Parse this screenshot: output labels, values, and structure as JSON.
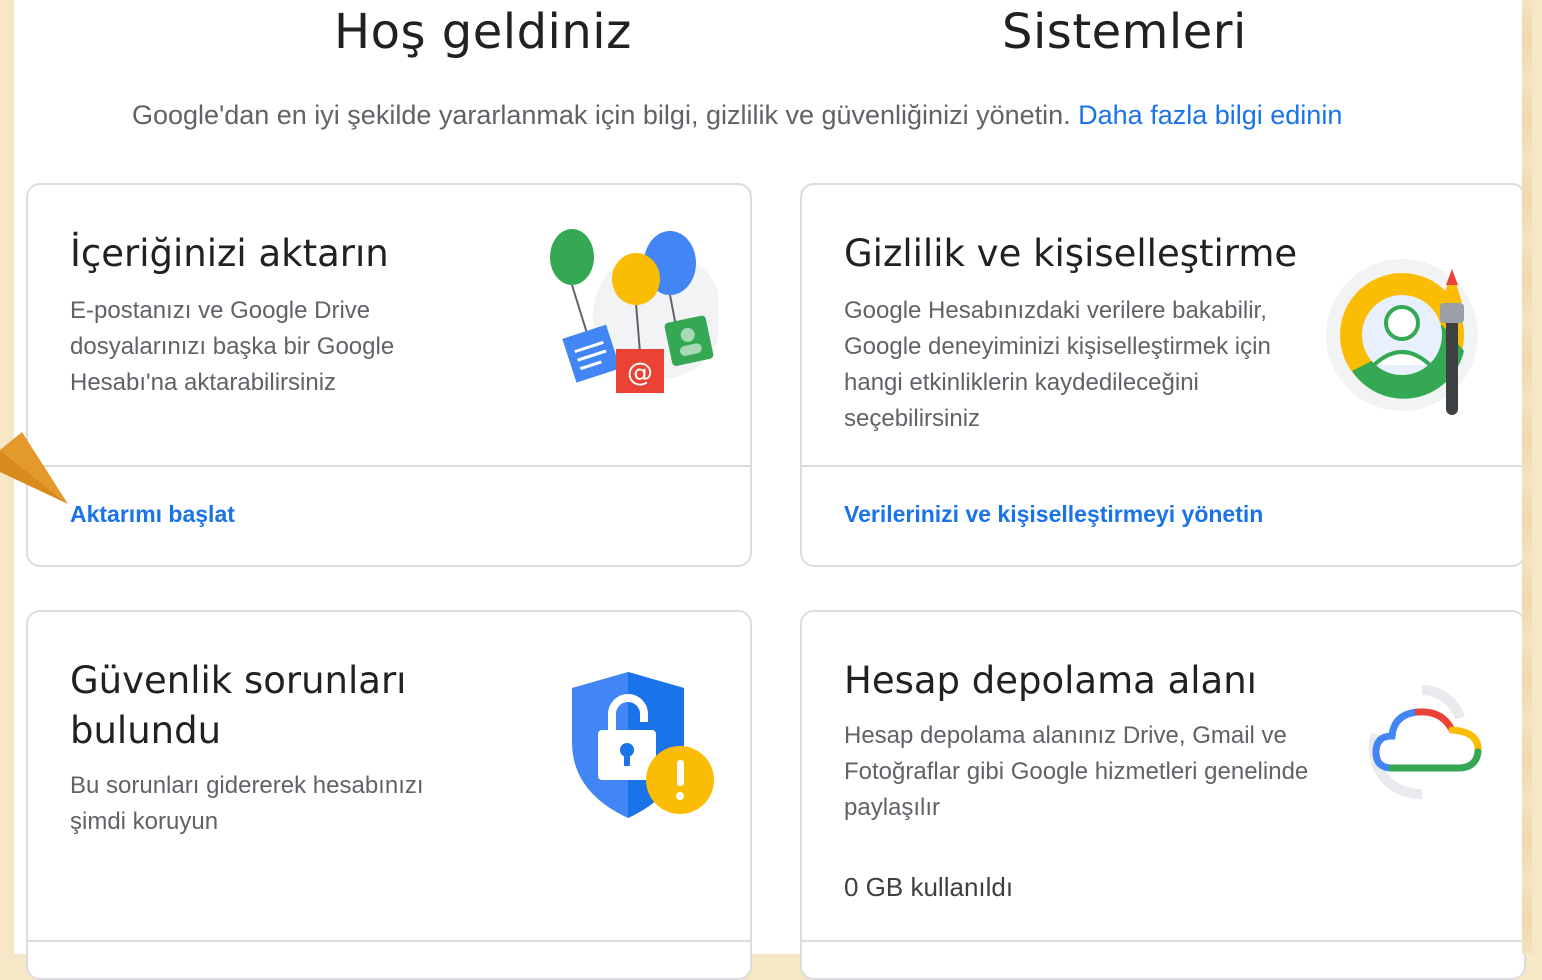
{
  "header": {
    "title_left": "Hoş geldiniz",
    "title_right": "Sistemleri",
    "subtitle": "Google'dan en iyi şekilde yararlanmak için bilgi, gizlilik ve güvenliğinizi yönetin.",
    "learn_more": "Daha fazla bilgi edinin"
  },
  "cards": {
    "transfer": {
      "title": "İçeriğinizi aktarın",
      "description": "E-postanızı ve Google Drive dosyalarınızı başka bir Google Hesabı'na aktarabilirsiniz",
      "action": "Aktarımı başlat",
      "icon": "balloons-icon"
    },
    "privacy": {
      "title": "Gizlilik ve kişiselleştirme",
      "description": "Google Hesabınızdaki verilere bakabilir, Google deneyiminizi kişiselleştirmek için hangi etkinliklerin kaydedileceğini seçebilirsiniz",
      "action": "Verilerinizi ve kişiselleştirmeyi yönetin",
      "icon": "privacy-paintbrush-icon"
    },
    "security": {
      "title": "Güvenlik sorunları bulundu",
      "description": "Bu sorunları gidererek hesabınızı şimdi koruyun",
      "icon": "shield-warning-icon"
    },
    "storage": {
      "title": "Hesap depolama alanı",
      "description": "Hesap depolama alanınız Drive, Gmail ve Fotoğraflar gibi Google hizmetleri genelinde paylaşılır",
      "usage": "0 GB kullanıldı",
      "icon": "cloud-icon"
    }
  },
  "colors": {
    "accent": "#1a73e8",
    "annotation_arrow": "#e39a2b",
    "background": "#f6e7c6"
  }
}
